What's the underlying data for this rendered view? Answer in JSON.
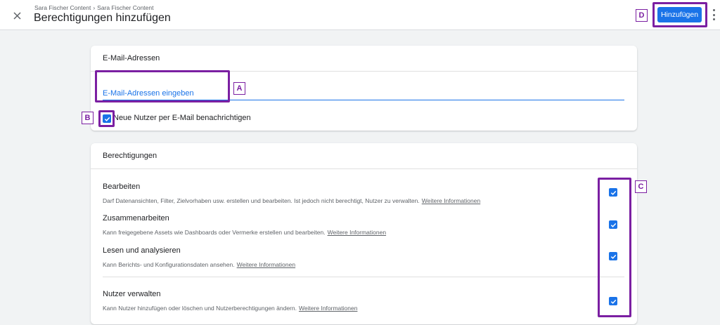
{
  "header": {
    "breadcrumb": [
      "Sara Fischer Content",
      "Sara Fischer Content"
    ],
    "breadcrumb_separator": "›",
    "title": "Berechtigungen hinzufügen",
    "add_label": "Hinzufügen",
    "close_icon": "close-icon",
    "more_icon": "more-vert-icon"
  },
  "email_card": {
    "title": "E-Mail-Adressen",
    "input_placeholder": "E-Mail-Adressen eingeben",
    "input_value": "",
    "notify_label": "Neue Nutzer per E-Mail benachrichtigen",
    "notify_checked": true
  },
  "permissions_card": {
    "title": "Berechtigungen",
    "link_label": "Weitere Informationen",
    "items": [
      {
        "title": "Bearbeiten",
        "description": "Darf Datenansichten, Filter, Zielvorhaben usw. erstellen und bearbeiten. Ist jedoch nicht berechtigt, Nutzer zu verwalten.",
        "checked": true
      },
      {
        "title": "Zusammenarbeiten",
        "description": "Kann freigegebene Assets wie Dashboards oder Vermerke erstellen und bearbeiten.",
        "checked": true
      },
      {
        "title": "Lesen und analysieren",
        "description": "Kann Berichts- und Konfigurationsdaten ansehen.",
        "checked": true
      },
      {
        "title": "Nutzer verwalten",
        "description": "Kann Nutzer hinzufügen oder löschen und Nutzerberechtigungen ändern.",
        "checked": true
      }
    ]
  },
  "annotations": {
    "a": "A",
    "b": "B",
    "c": "C",
    "d": "D",
    "color": "#7b1fa2"
  },
  "colors": {
    "accent": "#1a73e8",
    "background": "#f1f3f4"
  }
}
